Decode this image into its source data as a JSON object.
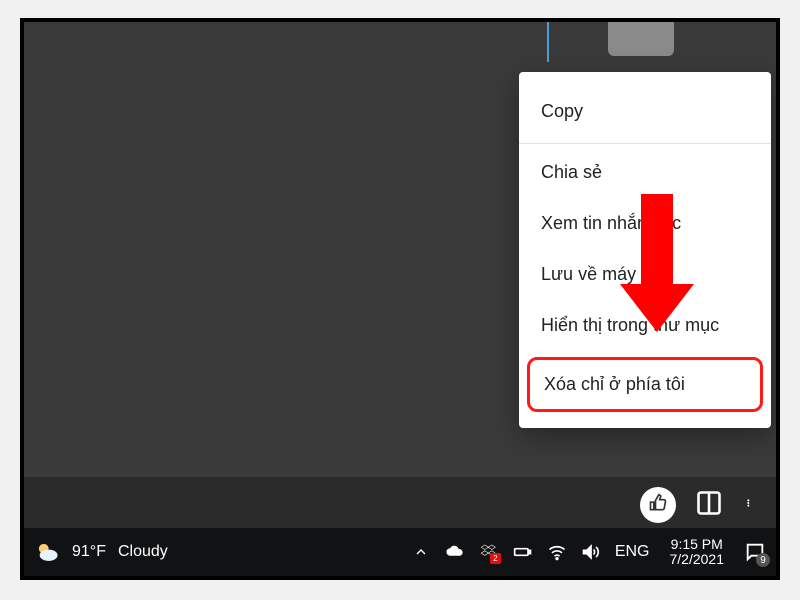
{
  "context_menu": {
    "items": {
      "copy": "Copy",
      "share": "Chia sẻ",
      "view_original": "Xem tin nhắn gốc",
      "save": "Lưu về máy",
      "show_in_folder": "Hiển thị trong thư mục",
      "delete_for_me": "Xóa chỉ ở phía tôi"
    }
  },
  "toolbar": {
    "like": "",
    "layout": "",
    "more": ""
  },
  "taskbar": {
    "weather_temp": "91°F",
    "weather_text": "Cloudy",
    "ime_lang": "ENG",
    "time": "9:15 PM",
    "date": "7/2/2021",
    "notif_count": "9",
    "dropbox_count": "2"
  }
}
